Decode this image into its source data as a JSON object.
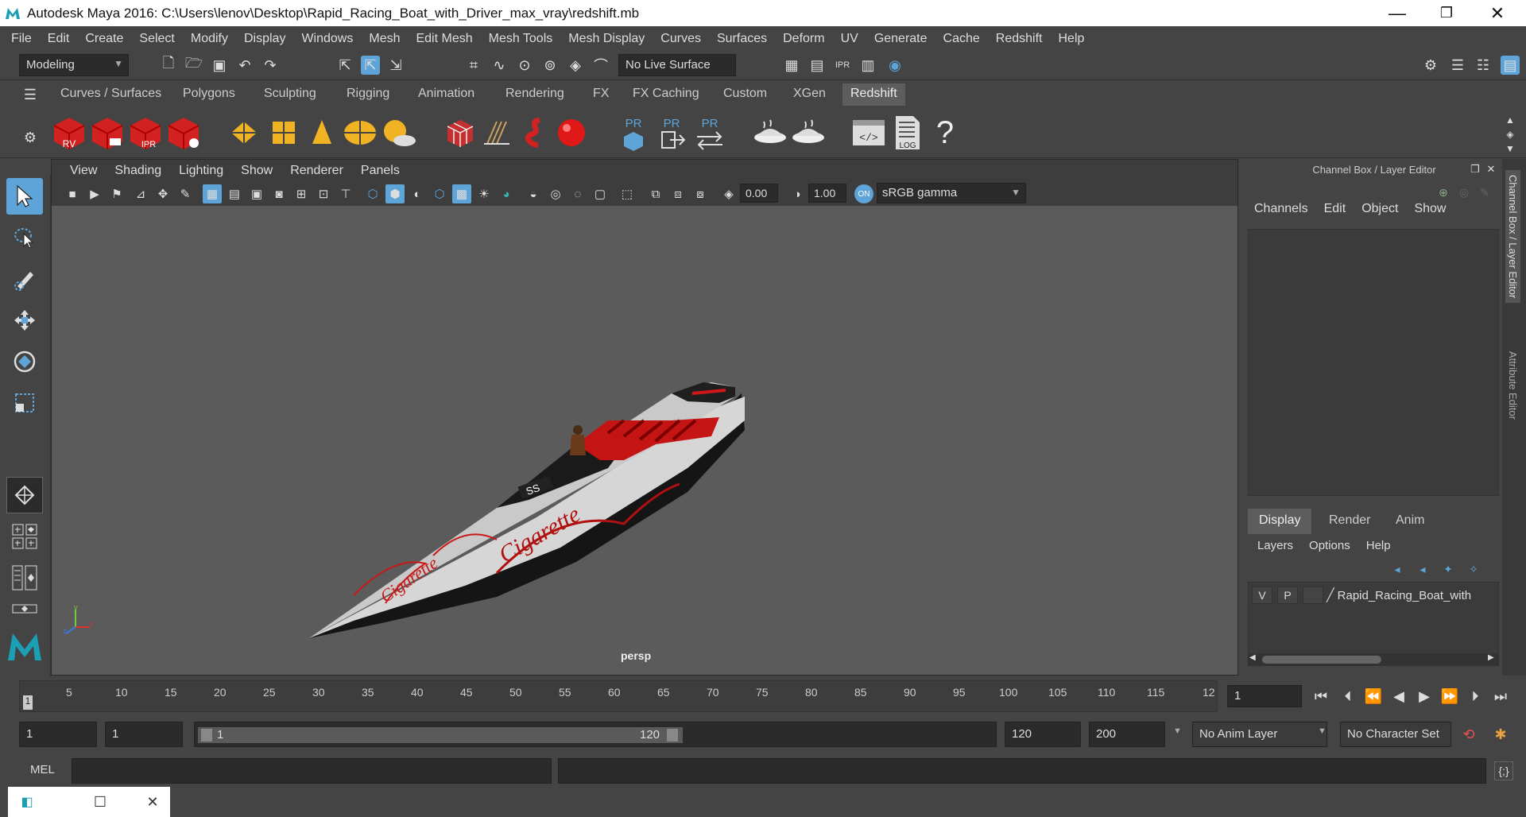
{
  "window": {
    "title": "Autodesk Maya 2016: C:\\Users\\lenov\\Desktop\\Rapid_Racing_Boat_with_Driver_max_vray\\redshift.mb",
    "minimize": "—",
    "maximize": "❐",
    "close": "✕"
  },
  "menubar": [
    "File",
    "Edit",
    "Create",
    "Select",
    "Modify",
    "Display",
    "Windows",
    "Mesh",
    "Edit Mesh",
    "Mesh Tools",
    "Mesh Display",
    "Curves",
    "Surfaces",
    "Deform",
    "UV",
    "Generate",
    "Cache",
    "Redshift",
    "Help"
  ],
  "statusline": {
    "mode": "Modeling",
    "live_surface": "No Live Surface"
  },
  "shelf_tabs": [
    "Curves / Surfaces",
    "Polygons",
    "Sculpting",
    "Rigging",
    "Animation",
    "Rendering",
    "FX",
    "FX Caching",
    "Custom",
    "XGen",
    "Redshift"
  ],
  "shelf_active": "Redshift",
  "shelf_icons": {
    "rv": "RV",
    "ipr": "IPR",
    "pr": "PR",
    "log": "LOG",
    "help": "?"
  },
  "panel_menu": [
    "View",
    "Shading",
    "Lighting",
    "Show",
    "Renderer",
    "Panels"
  ],
  "panel_toolbar": {
    "exposure": "0.00",
    "gamma": "1.00",
    "color_space": "sRGB gamma"
  },
  "viewport": {
    "camera": "persp",
    "axis_x": "x",
    "axis_y": "y",
    "axis_z": "z",
    "hull_text_1": "Cigarette",
    "hull_text_2": "Cigarette",
    "deck_badge": "SS"
  },
  "channel_box": {
    "title": "Channel Box / Layer Editor",
    "menus": [
      "Channels",
      "Edit",
      "Object",
      "Show"
    ],
    "layer_tabs": [
      "Display",
      "Render",
      "Anim"
    ],
    "layer_tab_active": "Display",
    "layer_menus": [
      "Layers",
      "Options",
      "Help"
    ],
    "layer": {
      "v": "V",
      "p": "P",
      "name": "Rapid_Racing_Boat_with"
    }
  },
  "side_tabs": [
    "Channel Box / Layer Editor",
    "Attribute Editor"
  ],
  "timeline": {
    "ticks": [
      "5",
      "10",
      "15",
      "20",
      "25",
      "30",
      "35",
      "40",
      "45",
      "50",
      "55",
      "60",
      "65",
      "70",
      "75",
      "80",
      "85",
      "90",
      "95",
      "100",
      "105",
      "110",
      "115",
      "12"
    ],
    "current_frame": "1",
    "current_marker": "1"
  },
  "range": {
    "start": "1",
    "inner_start": "1",
    "slider_start": "1",
    "slider_end": "120",
    "end": "120",
    "max": "200",
    "anim_layer": "No Anim Layer",
    "char_set": "No Character Set"
  },
  "cmdline": {
    "label": "MEL"
  },
  "colors": {
    "bg": "#444444",
    "viewport": "#5b5b5b",
    "accent": "#5ea4d8",
    "red": "#e01818"
  }
}
